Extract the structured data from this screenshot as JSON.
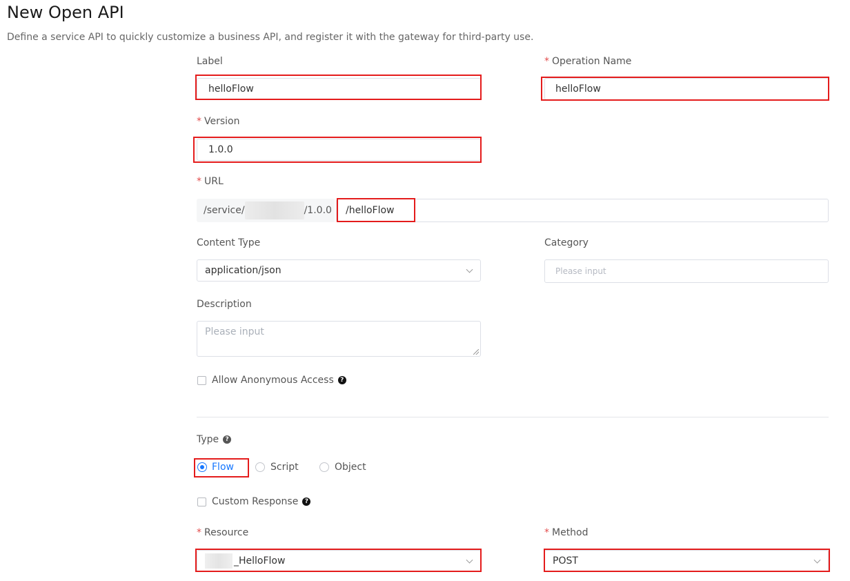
{
  "page": {
    "title": "New Open API",
    "description": "Define a service API to quickly customize a business API, and register it with the gateway for third-party use."
  },
  "form": {
    "label": {
      "label": "Label",
      "value": "helloFlow"
    },
    "operation_name": {
      "label": "Operation Name",
      "value": "helloFlow",
      "required": "*"
    },
    "version": {
      "label": "Version",
      "value": "1.0.0",
      "required": "*"
    },
    "url": {
      "label": "URL",
      "required": "*",
      "prefix_start": "/service/",
      "prefix_end": "/1.0.0",
      "value": "/helloFlow"
    },
    "content_type": {
      "label": "Content Type",
      "value": "application/json"
    },
    "category": {
      "label": "Category",
      "placeholder": "Please input"
    },
    "description": {
      "label": "Description",
      "placeholder": "Please input"
    },
    "allow_anonymous": {
      "label": "Allow Anonymous Access",
      "checked": false
    },
    "type": {
      "label": "Type",
      "options": [
        {
          "label": "Flow",
          "checked": true
        },
        {
          "label": "Script",
          "checked": false
        },
        {
          "label": "Object",
          "checked": false
        }
      ]
    },
    "custom_response": {
      "label": "Custom Response",
      "checked": false
    },
    "resource": {
      "label": "Resource",
      "required": "*",
      "value": "_HelloFlow"
    },
    "method": {
      "label": "Method",
      "required": "*",
      "value": "POST"
    }
  },
  "icons": {
    "help": "?"
  },
  "colors": {
    "accent": "#1677ff",
    "required": "#e34d4d",
    "highlight": "#e41b1b"
  }
}
